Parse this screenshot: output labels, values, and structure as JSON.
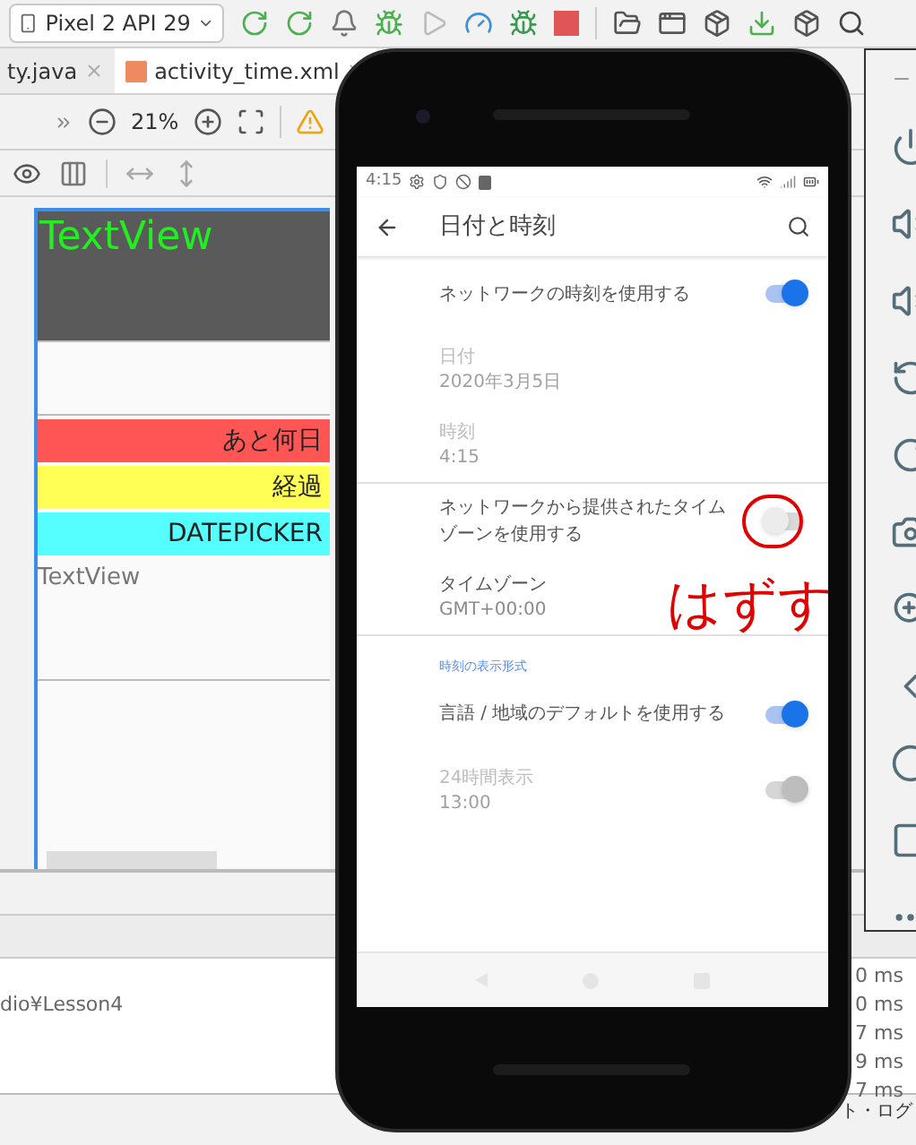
{
  "toolbar": {
    "device": "Pixel 2 API 29"
  },
  "tabs": [
    {
      "label": "ty.java",
      "selected": false
    },
    {
      "label": "activity_time.xml",
      "selected": true
    }
  ],
  "design_toolbar": {
    "zoom": "21%"
  },
  "preview": {
    "header_text": "TextView",
    "buttons": [
      {
        "label": "あと何日",
        "color": "#ff5555"
      },
      {
        "label": "経過",
        "color": "#ffff55"
      },
      {
        "label": "DATEPICKER",
        "color": "#55ffff"
      }
    ],
    "text": "TextView"
  },
  "console": {
    "path": "dio¥Lesson4",
    "timings": [
      "0 ms",
      "0 ms",
      "7 ms",
      "9 ms",
      "7 ms"
    ]
  },
  "status_bar": {
    "event_log": "ト・ログ"
  },
  "emulator": {
    "status_time": "4:15",
    "title": "日付と時刻",
    "sections": [
      {
        "items": [
          {
            "kind": "toggle",
            "title": "ネットワークの時刻を使用する",
            "on": true,
            "disabled": false
          },
          {
            "kind": "info",
            "title": "日付",
            "summary": "2020年3月5日",
            "disabled": true
          },
          {
            "kind": "info",
            "title": "時刻",
            "summary": "4:15",
            "disabled": true
          }
        ]
      },
      {
        "items": [
          {
            "kind": "toggle",
            "title": "ネットワークから提供されたタイムゾーンを使用する",
            "on": false,
            "disabled": false
          },
          {
            "kind": "info",
            "title": "タイムゾーン",
            "summary": "GMT+00:00",
            "disabled": false
          }
        ]
      },
      {
        "header": "時刻の表示形式",
        "items": [
          {
            "kind": "toggle",
            "title": "言語 / 地域のデフォルトを使用する",
            "on": true,
            "disabled": false
          },
          {
            "kind": "toggle",
            "title": "24時間表示",
            "summary": "13:00",
            "on": true,
            "disabled": true
          }
        ]
      }
    ]
  },
  "annotation": {
    "text": "はずす"
  }
}
